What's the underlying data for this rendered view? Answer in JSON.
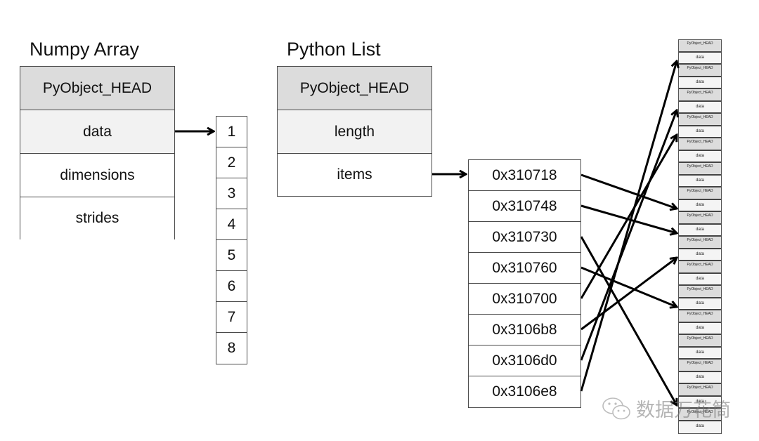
{
  "numpy_array": {
    "title": "Numpy Array",
    "fields": [
      "PyObject_HEAD",
      "data",
      "dimensions",
      "strides"
    ],
    "data_values": [
      "1",
      "2",
      "3",
      "4",
      "5",
      "6",
      "7",
      "8"
    ]
  },
  "python_list": {
    "title": "Python List",
    "fields": [
      "PyObject_HEAD",
      "length",
      "items"
    ],
    "addresses": [
      "0x310718",
      "0x310748",
      "0x310730",
      "0x310760",
      "0x310700",
      "0x3106b8",
      "0x3106d0",
      "0x3106e8"
    ]
  },
  "objects_column": {
    "block_count": 16,
    "head_label": "PyObject_HEAD",
    "data_label": "data"
  },
  "pointer_targets": {
    "0x310718": 7,
    "0x310748": 8,
    "0x310730": 15,
    "0x310760": 11,
    "0x310700": 4,
    "0x3106b8": 9,
    "0x3106d0": 3,
    "0x3106e8": 1
  },
  "watermark": {
    "text": "数据万花筒",
    "icon": "wechat-icon"
  }
}
